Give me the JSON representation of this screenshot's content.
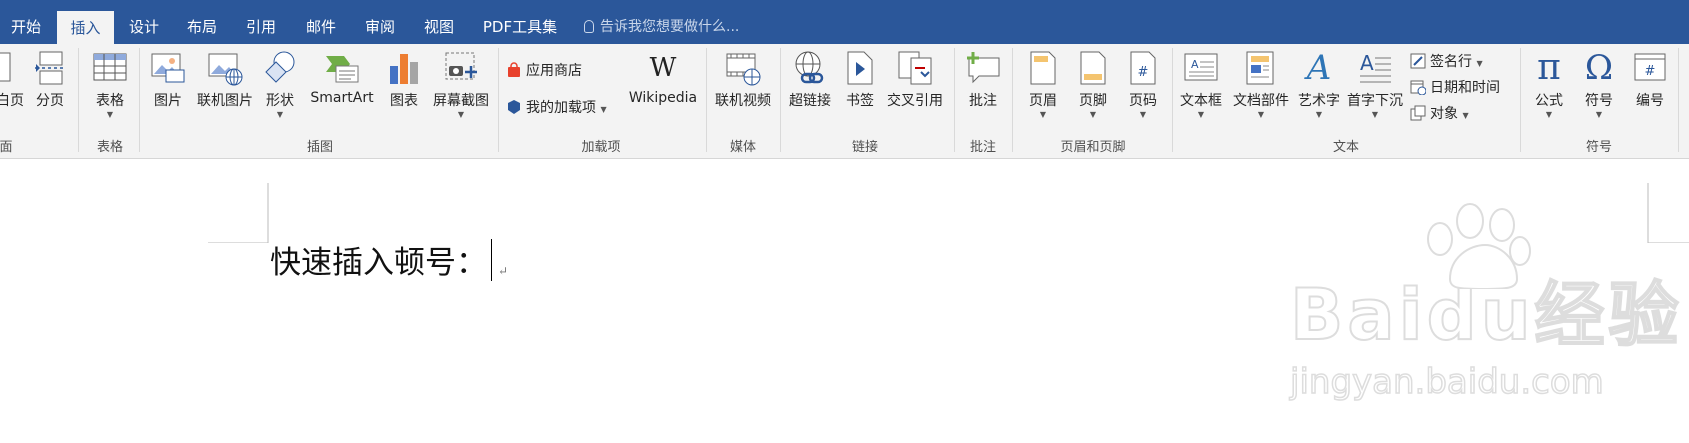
{
  "tabs": [
    "开始",
    "插入",
    "设计",
    "布局",
    "引用",
    "邮件",
    "审阅",
    "视图",
    "PDF工具集"
  ],
  "active_tab": "插入",
  "tell_me_placeholder": "告诉我您想要做什么...",
  "ribbon": {
    "pages": {
      "partial_label": "白页",
      "page_break": "分页",
      "group": "面"
    },
    "tables": {
      "table": "表格",
      "group": "表格"
    },
    "illustrations": {
      "picture": "图片",
      "online_picture": "联机图片",
      "shapes": "形状",
      "smartart": "SmartArt",
      "chart": "图表",
      "screenshot": "屏幕截图",
      "group": "插图"
    },
    "addins": {
      "store": "应用商店",
      "my_addins": "我的加载项",
      "wikipedia": "Wikipedia",
      "group": "加载项"
    },
    "media": {
      "online_video": "联机视频",
      "group": "媒体"
    },
    "links": {
      "hyperlink": "超链接",
      "bookmark": "书签",
      "cross_ref": "交叉引用",
      "group": "链接"
    },
    "comments": {
      "comment": "批注",
      "group": "批注"
    },
    "header_footer": {
      "header": "页眉",
      "footer": "页脚",
      "page_number": "页码",
      "group": "页眉和页脚"
    },
    "text": {
      "textbox": "文本框",
      "quick_parts": "文档部件",
      "wordart": "艺术字",
      "dropcap": "首字下沉",
      "signature": "签名行",
      "datetime": "日期和时间",
      "object": "对象",
      "group": "文本"
    },
    "symbols": {
      "equation": "公式",
      "symbol": "符号",
      "numbering": "编号",
      "group": "符号"
    }
  },
  "document": {
    "text": "快速插入顿号："
  },
  "watermark": {
    "logo": "Baidu经验",
    "url": "jingyan.baidu.com"
  }
}
